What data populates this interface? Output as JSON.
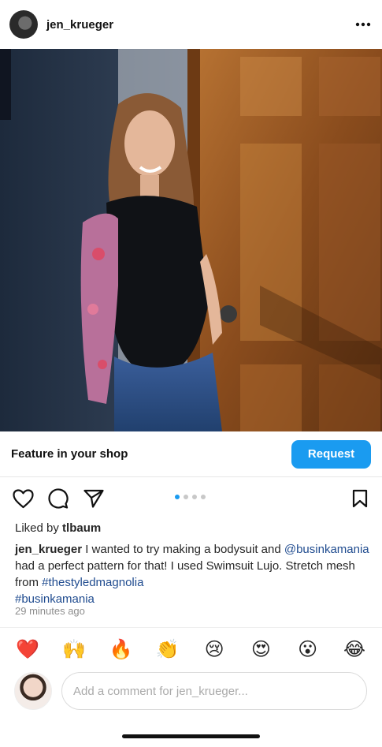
{
  "header": {
    "username": "jen_krueger",
    "more_icon": "more-horizontal-icon"
  },
  "shop_bar": {
    "label": "Feature in your shop",
    "request_label": "Request"
  },
  "actions": {
    "icons": [
      "heart-icon",
      "comment-icon",
      "share-icon",
      "bookmark-icon"
    ],
    "carousel_dots": 4,
    "carousel_active_index": 0
  },
  "likes": {
    "prefix": "Liked by ",
    "user": "tlbaum"
  },
  "caption": {
    "username": "jen_krueger",
    "text_1": " I wanted to try making a bodysuit and ",
    "mention": "@businkamania",
    "text_2": " had a perfect pattern for that! I used Swimsuit Lujo. Stretch mesh from ",
    "hashtag_1": "#thestyledmagnolia",
    "hashtag_2": "#businkamania"
  },
  "timestamp": "29 minutes ago",
  "reactions": [
    "❤️",
    "🙌",
    "🔥",
    "👏",
    "😢",
    "😍",
    "😮",
    "😂"
  ],
  "comment": {
    "placeholder": "Add a comment for jen_krueger..."
  },
  "colors": {
    "accent": "#1a9bf0",
    "hashtag": "#1f4b8f"
  }
}
